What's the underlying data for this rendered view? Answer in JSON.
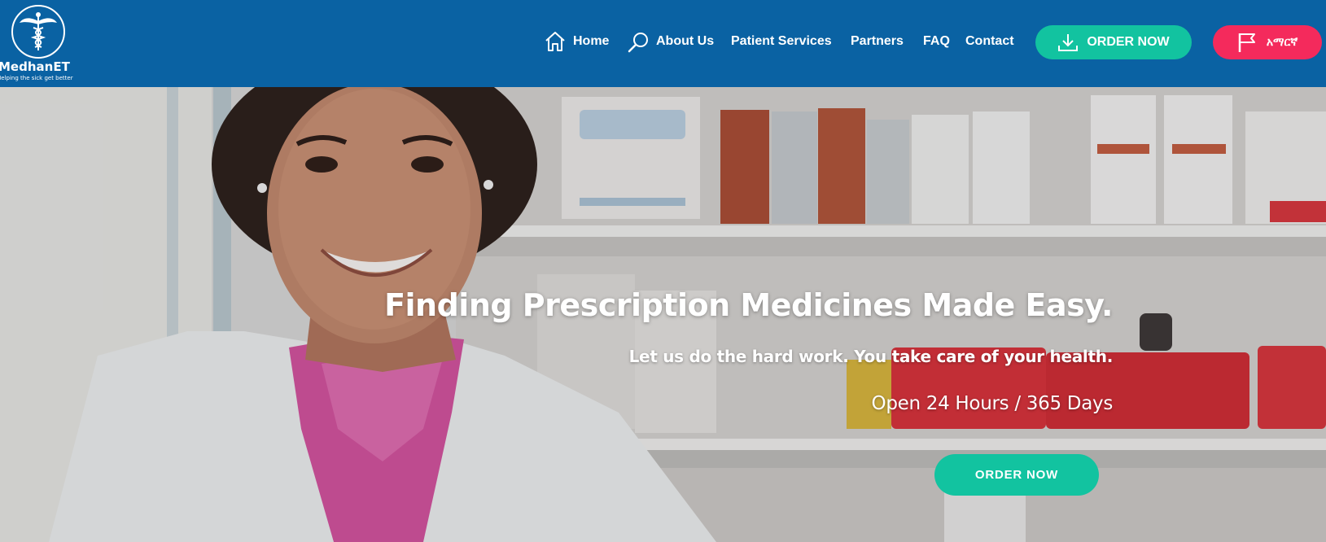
{
  "brand": {
    "name": "MedhanET",
    "tagline": "Helping the sick get better"
  },
  "nav": {
    "items": [
      {
        "label": "Home",
        "icon": "home-icon"
      },
      {
        "label": "About Us",
        "icon": "search-icon"
      },
      {
        "label": "Patient Services"
      },
      {
        "label": "Partners"
      },
      {
        "label": "FAQ"
      },
      {
        "label": "Contact"
      }
    ],
    "order_button": {
      "label": "ORDER NOW",
      "icon": "download-icon"
    },
    "language_button": {
      "label": "አማርኛ",
      "icon": "flag-icon"
    }
  },
  "hero": {
    "title": "Finding Prescription Medicines Made Easy.",
    "subtitle": "Let us do the hard work. You take care of your health.",
    "hours": "Open 24 Hours / 365 Days",
    "cta_label": "ORDER NOW"
  },
  "colors": {
    "header_bg": "#0a62a3",
    "accent_green": "#12c3a0",
    "accent_pink": "#f42a5c",
    "text_light": "#ffffff"
  }
}
